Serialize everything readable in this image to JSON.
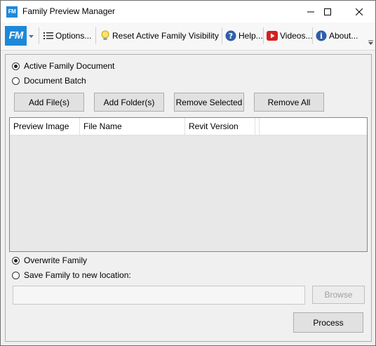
{
  "window": {
    "title": "Family Preview Manager",
    "app_icon_text": "FM"
  },
  "toolbar": {
    "logo_text": "FM",
    "options_label": "Options...",
    "reset_label": "Reset Active Family Visibility",
    "help_label": "Help...",
    "videos_label": "Videos...",
    "about_label": "About..."
  },
  "source": {
    "active_family_label": "Active Family Document",
    "document_batch_label": "Document Batch",
    "selected": "Active Family Document"
  },
  "buttons": {
    "add_files": "Add File(s)",
    "add_folders": "Add Folder(s)",
    "remove_selected": "Remove Selected",
    "remove_all": "Remove All"
  },
  "grid": {
    "columns": [
      "Preview Image",
      "File Name",
      "Revit Version",
      ""
    ],
    "rows": []
  },
  "output": {
    "overwrite_label": "Overwrite Family",
    "save_new_label": "Save Family to new location:",
    "selected": "Overwrite Family",
    "path_value": "",
    "browse_label": "Browse",
    "process_label": "Process"
  }
}
